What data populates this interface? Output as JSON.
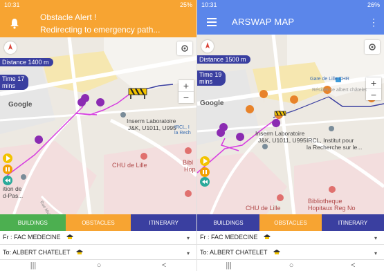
{
  "left": {
    "status": {
      "time": "10:31",
      "right": "25%"
    },
    "notification": {
      "title": "Obstacle Alert !",
      "message": "Redirecting to emergency path..."
    },
    "distance": "Distance 1400 m",
    "time_label": "Time",
    "time_value": "17",
    "time_unit": "mins",
    "google": "Google",
    "labels": [
      "Inserm Laboratoire",
      "J&K, U1011, U995",
      "IRCL, I",
      "la Rech",
      "CHU de Lille",
      "Bibl",
      "Hop",
      "ition de",
      "d-Pas...",
      "Rue Michel Polonovski"
    ]
  },
  "right": {
    "status": {
      "time": "10:31",
      "right": "26%"
    },
    "app_title": "ARSWAP MAP",
    "distance": "Distance 1500 m",
    "time_label": "Time",
    "time_value": "19",
    "time_unit": "mins",
    "google": "Google",
    "labels": [
      "Gare de Lille CHR",
      "Résidence albert châtelet",
      "Inserm Laboratoire",
      "J&K, U1011, U995",
      "IRCL, Institut pour",
      "la Recherche sur le...",
      "CHU de Lille",
      "Bibliotheque",
      "Hopitaux Reg No"
    ]
  },
  "tabs": {
    "buildings": "BUILDINGS",
    "obstacles": "OBSTACLES",
    "itinerary": "ITINERARY"
  },
  "from_field": "Fr : FAC MEDECINE",
  "to_field": "To: ALBERT CHATELET",
  "nav": {
    "recent": "|||",
    "home": "○",
    "back": "<"
  },
  "zoom": {
    "plus": "+",
    "minus": "−"
  },
  "colors": {
    "orange": "#f7a432",
    "blue": "#5b86ea",
    "navy": "#3a3fa0",
    "green": "#4caf50",
    "route": "#d63de0"
  }
}
